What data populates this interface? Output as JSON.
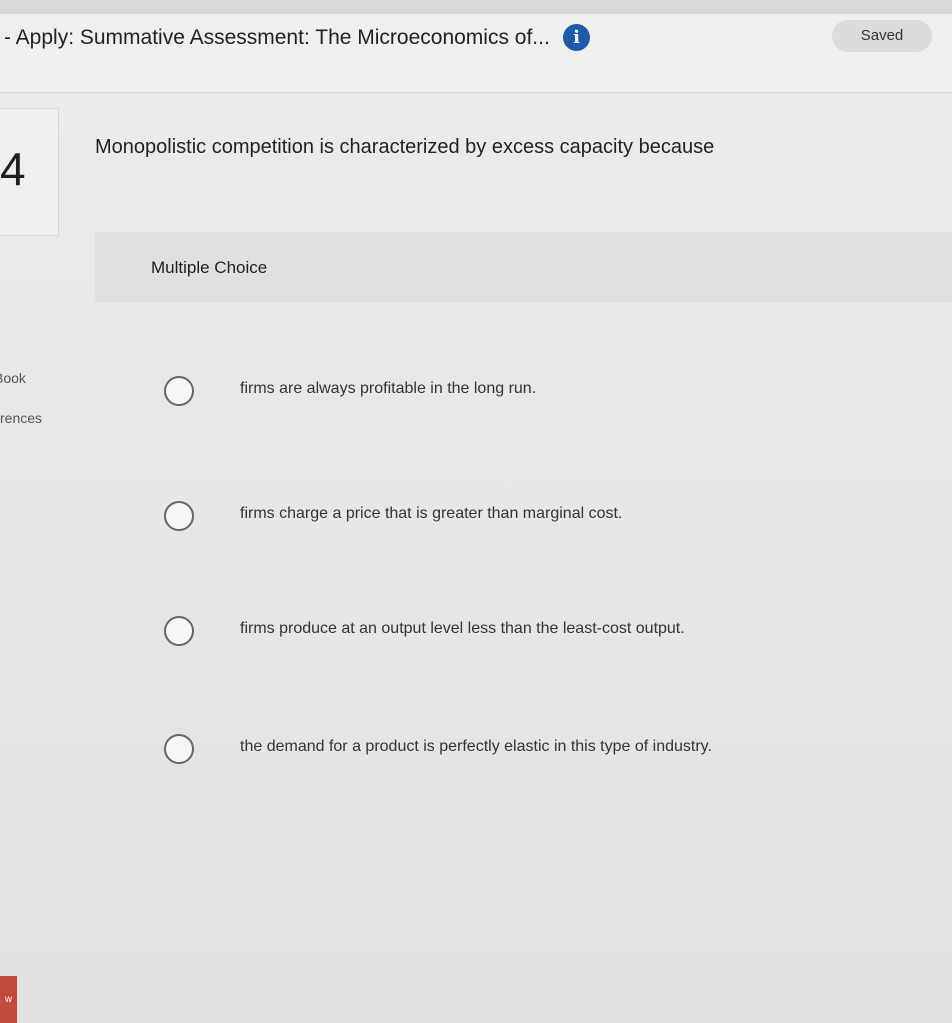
{
  "header": {
    "title": "- Apply: Summative Assessment: The Microeconomics of...",
    "info_icon": "info-icon",
    "saved_label": "Saved"
  },
  "question": {
    "number": "4",
    "text": "Monopolistic competition is characterized by excess capacity because",
    "type_label": "Multiple Choice",
    "options": [
      "firms are always profitable in the long run.",
      "firms charge a price that is greater than marginal cost.",
      "firms produce at an output level less than the least-cost output.",
      "the demand for a product is perfectly elastic in this type of industry."
    ]
  },
  "sidebar": {
    "items": [
      "Book",
      "rences"
    ]
  },
  "corner_badge": "w",
  "colors": {
    "info_icon": "#1d5aa8",
    "corner_badge": "#c24a3c"
  }
}
